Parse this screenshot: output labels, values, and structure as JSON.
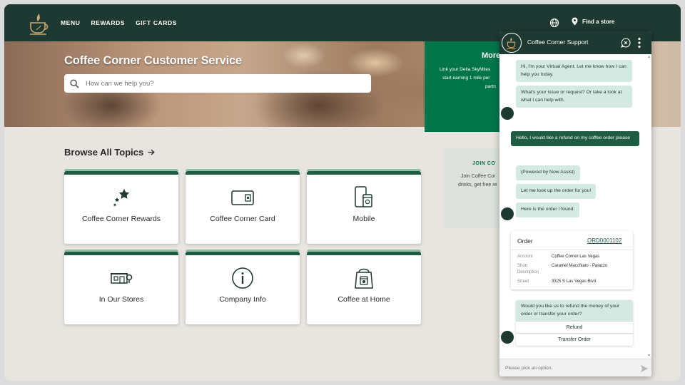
{
  "nav": {
    "links": [
      "MENU",
      "REWARDS",
      "GIFT CARDS"
    ],
    "find_store": "Find a store",
    "icons": {
      "logo": "coffee-cup-logo",
      "globe": "globe-icon",
      "pin": "map-pin-icon"
    }
  },
  "hero": {
    "title": "Coffee Corner Customer Service",
    "search_placeholder": "How can we help you?"
  },
  "promo": {
    "title": "More",
    "line1": "Link your Delta SkyMiles",
    "line2": "start earning 1 mile per",
    "line3": "partn"
  },
  "browse": {
    "title": "Browse All Topics",
    "topics": [
      {
        "label": "Coffee Corner Rewards",
        "icon": "stars-icon"
      },
      {
        "label": "Coffee Corner Card",
        "icon": "card-icon"
      },
      {
        "label": "Mobile",
        "icon": "mobile-cup-icon"
      },
      {
        "label": "In Our Stores",
        "icon": "store-icon"
      },
      {
        "label": "Company Info",
        "icon": "info-icon"
      },
      {
        "label": "Coffee at Home",
        "icon": "coffee-bag-icon"
      }
    ]
  },
  "join": {
    "title": "JOIN CO",
    "line1": "Join Coffee Cor",
    "line2": "drinks, get free re"
  },
  "chat": {
    "title": "Coffee Corner Support",
    "messages": {
      "m1": "Hi, I'm your Virtual Agent. Let me know how I can help you today.",
      "m2": "What's your issue or request? Or take a look at what I can help with.",
      "user1": "Hello, I would like a refund on my coffee order please",
      "m3": "(Powered by Now Assist)",
      "m4": "Let me look up the order for you!",
      "m5": "Here is the order I found:"
    },
    "order": {
      "heading": "Order",
      "number": "ORD0001102",
      "account_key": "Account",
      "account_val": "Coffee Corner Las Vegas",
      "desc_key1": "Short",
      "desc_key2": "Description",
      "desc_val": "Caramel Macchiato - Palazzo",
      "street_key": "Street",
      "street_val": "3325 S Las Vegas Blvd"
    },
    "question": "Would you like us to refund the money of your order or transfer your order?",
    "options": [
      "Refund",
      "Transfer Order"
    ],
    "input_placeholder": "Please pick an option."
  },
  "colors": {
    "brand_dark": "#1e3932",
    "brand_green": "#00754a",
    "bubble": "#d4e9e2",
    "user_bubble": "#1e5c43"
  }
}
